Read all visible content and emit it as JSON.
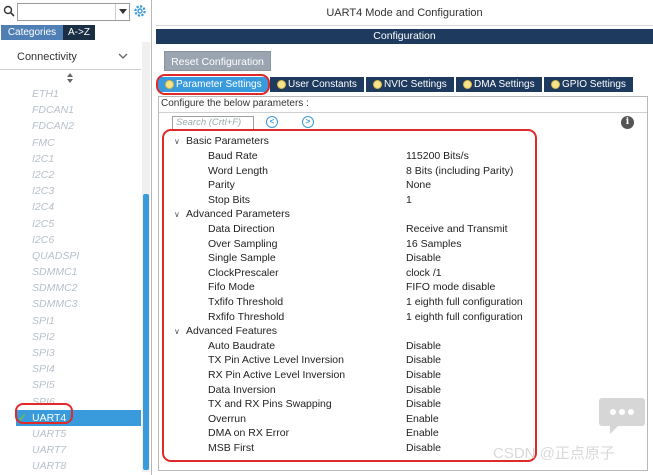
{
  "left_panel": {
    "search": {
      "value": ""
    },
    "tabs": {
      "categories": "Categories",
      "az": "A->Z"
    },
    "section": {
      "label": "Connectivity"
    },
    "peripherals": [
      {
        "name": "ETH1"
      },
      {
        "name": "FDCAN1"
      },
      {
        "name": "FDCAN2"
      },
      {
        "name": "FMC"
      },
      {
        "name": "I2C1"
      },
      {
        "name": "I2C2"
      },
      {
        "name": "I2C3"
      },
      {
        "name": "I2C4"
      },
      {
        "name": "I2C5"
      },
      {
        "name": "I2C6"
      },
      {
        "name": "QUADSPI"
      },
      {
        "name": "SDMMC1"
      },
      {
        "name": "SDMMC2"
      },
      {
        "name": "SDMMC3"
      },
      {
        "name": "SPI1"
      },
      {
        "name": "SPI2"
      },
      {
        "name": "SPI3"
      },
      {
        "name": "SPI4"
      },
      {
        "name": "SPI5"
      },
      {
        "name": "SPI6"
      },
      {
        "name": "UART4",
        "selected": true,
        "check": "✓"
      },
      {
        "name": "UART5"
      },
      {
        "name": "UART7"
      },
      {
        "name": "UART8"
      }
    ]
  },
  "right_panel": {
    "mode_title": "UART4 Mode and Configuration",
    "configuration_label": "Configuration",
    "reset_button": "Reset Configuration",
    "config_tabs": [
      {
        "label": "Parameter Settings",
        "active": true
      },
      {
        "label": "User Constants"
      },
      {
        "label": "NVIC Settings"
      },
      {
        "label": "DMA Settings"
      },
      {
        "label": "GPIO Settings"
      }
    ],
    "hint": "Configure the below parameters :",
    "search_placeholder": "Search (Crtl+F)",
    "info_icon": "i",
    "groups": [
      {
        "title": "Basic Parameters",
        "params": [
          {
            "name": "Baud Rate",
            "value": "115200 Bits/s"
          },
          {
            "name": "Word Length",
            "value": "8 Bits (including Parity)"
          },
          {
            "name": "Parity",
            "value": "None"
          },
          {
            "name": "Stop Bits",
            "value": "1"
          }
        ]
      },
      {
        "title": "Advanced Parameters",
        "params": [
          {
            "name": "Data Direction",
            "value": "Receive and Transmit"
          },
          {
            "name": "Over Sampling",
            "value": "16 Samples"
          },
          {
            "name": "Single Sample",
            "value": "Disable"
          },
          {
            "name": "ClockPrescaler",
            "value": "clock /1"
          },
          {
            "name": "Fifo Mode",
            "value": "FIFO mode disable"
          },
          {
            "name": "Txfifo Threshold",
            "value": "1 eighth full configuration"
          },
          {
            "name": "Rxfifo Threshold",
            "value": "1 eighth full configuration"
          }
        ]
      },
      {
        "title": "Advanced Features",
        "params": [
          {
            "name": "Auto Baudrate",
            "value": "Disable"
          },
          {
            "name": "TX Pin Active Level Inversion",
            "value": "Disable"
          },
          {
            "name": "RX Pin Active Level Inversion",
            "value": "Disable"
          },
          {
            "name": "Data Inversion",
            "value": "Disable"
          },
          {
            "name": "TX and RX Pins Swapping",
            "value": "Disable"
          },
          {
            "name": "Overrun",
            "value": "Enable"
          },
          {
            "name": "DMA on RX Error",
            "value": "Enable"
          },
          {
            "name": "MSB First",
            "value": "Disable"
          }
        ]
      }
    ]
  },
  "watermark": {
    "text": "CSDN @正点原子",
    "icon": "chat-bubble-icon"
  },
  "colors": {
    "accent_blue": "#3a9bdc",
    "dark_navy": "#1e3a5f",
    "highlight_red": "#e02a2a",
    "disabled_gray": "#b7c0cc",
    "check_green": "#6dc14b"
  }
}
